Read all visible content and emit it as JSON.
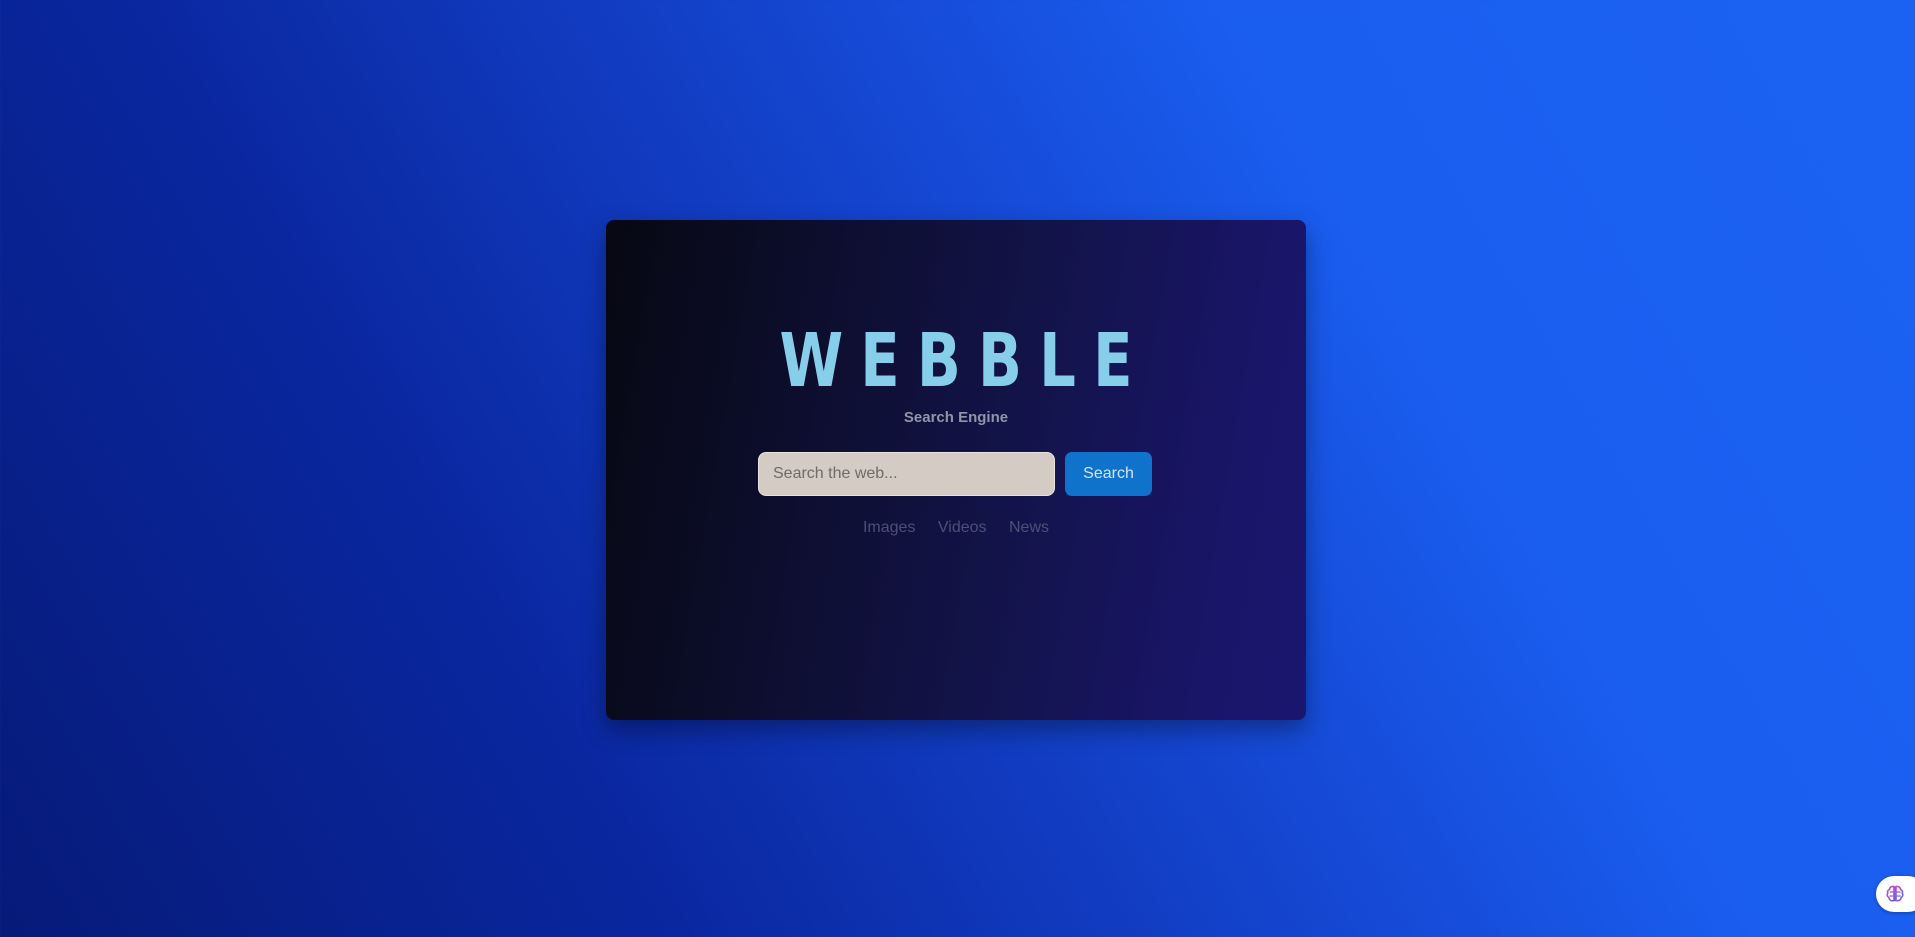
{
  "brand": {
    "logo_text": "WEBBLE",
    "subtitle": "Search Engine"
  },
  "search": {
    "placeholder": "Search the web...",
    "value": "",
    "button_label": "Search"
  },
  "nav_links": [
    {
      "label": "Images"
    },
    {
      "label": "Videos"
    },
    {
      "label": "News"
    }
  ],
  "corner_widget": {
    "icon": "brain-icon"
  },
  "colors": {
    "logo": "#87ceeb",
    "button": "#0f73cc",
    "input_bg": "#d4ccc4",
    "nav_link": "#4a5078",
    "subtitle": "#9096a8"
  }
}
